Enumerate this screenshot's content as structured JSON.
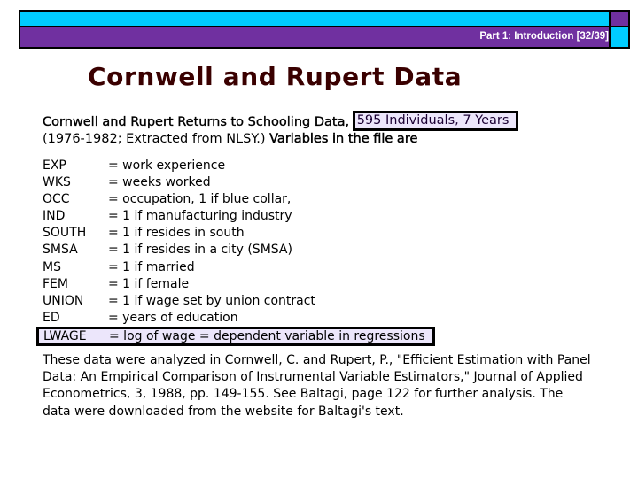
{
  "header": {
    "section_label": "Part 1: Introduction [32/39]",
    "colors": {
      "cyan": "#00ccff",
      "purple": "#7030a0"
    }
  },
  "slide": {
    "title": "Cornwell and Rupert Data",
    "intro": {
      "line1_prefix": "Cornwell and Rupert Returns to Schooling Data,",
      "line1_highlight": "595 Individuals, 7 Years",
      "line2_regular": "(1976-1982; Extracted from NLSY.)",
      "line2_bold": "Variables in the file are"
    },
    "variables": [
      {
        "name": "EXP",
        "desc": "= work experience"
      },
      {
        "name": "WKS",
        "desc": "= weeks worked"
      },
      {
        "name": "OCC",
        "desc": "= occupation, 1 if blue collar,"
      },
      {
        "name": "IND",
        "desc": "= 1 if manufacturing industry"
      },
      {
        "name": "SOUTH",
        "desc": "= 1 if resides in south"
      },
      {
        "name": "SMSA",
        "desc": "= 1 if resides in a city (SMSA)"
      },
      {
        "name": "MS",
        "desc": "= 1 if married"
      },
      {
        "name": "FEM",
        "desc": "= 1 if female"
      },
      {
        "name": "UNION",
        "desc": "= 1 if wage set by union contract"
      },
      {
        "name": "ED",
        "desc": "= years of education"
      },
      {
        "name": "LWAGE",
        "desc": "= log of wage = dependent variable in regressions"
      }
    ],
    "paragraph_lines": [
      "These data were analyzed in Cornwell, C. and Rupert, P., \"Efficient Estimation with Panel",
      "Data: An Empirical Comparison of Instrumental Variable Estimators,\" Journal of Applied",
      "Econometrics, 3, 1988, pp. 149-155.  See Baltagi, page 122 for further analysis.  The",
      "data were downloaded from the website for Baltagi's text."
    ],
    "highlight_color": "#ece6fb",
    "title_color": "#3a0000"
  }
}
